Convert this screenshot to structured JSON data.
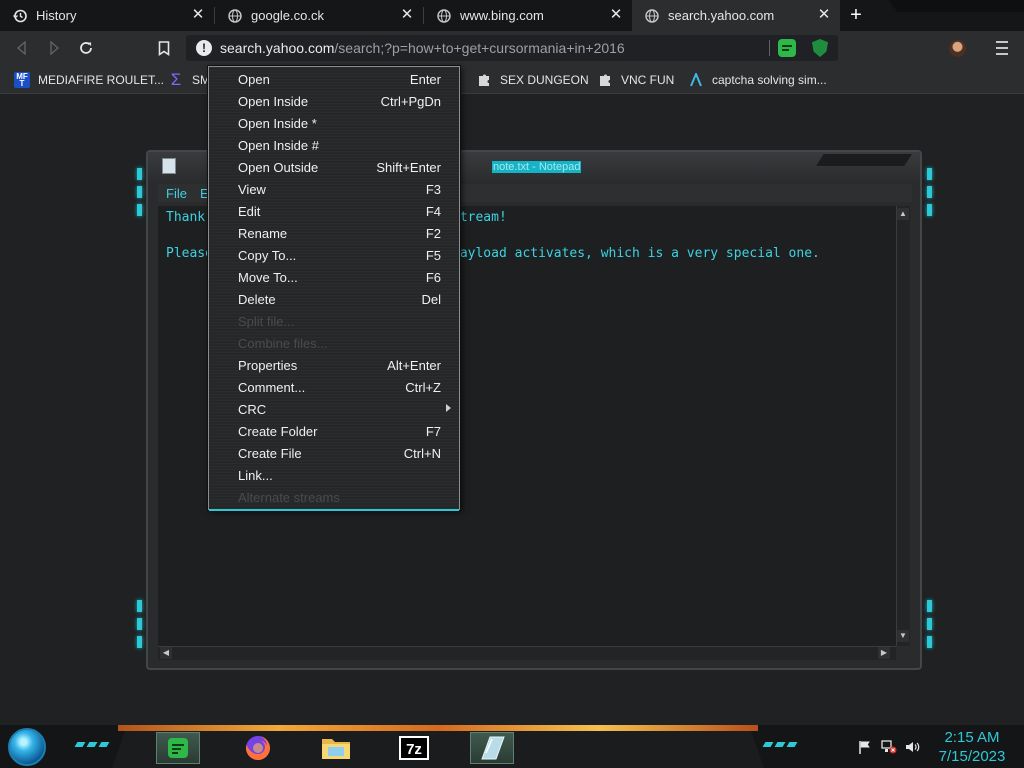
{
  "browser": {
    "tabs": [
      {
        "title": "History",
        "icon": "history-icon"
      },
      {
        "title": "google.co.ck",
        "icon": "globe-icon"
      },
      {
        "title": "www.bing.com",
        "icon": "globe-icon"
      },
      {
        "title": "search.yahoo.com",
        "icon": "globe-icon",
        "active": true
      }
    ],
    "address": {
      "host": "search.yahoo.com",
      "path": "/search;?p=how+to+get+cursormania+in+2016"
    },
    "bookmarks": [
      {
        "label": "MEDIAFIRE ROULET...",
        "icon": "mediafire-icon"
      },
      {
        "label": "SM",
        "icon": "sigma-icon"
      },
      {
        "label": "SEX DUNGEON",
        "icon": "puzzle-icon"
      },
      {
        "label": "VNC FUN",
        "icon": "puzzle-icon"
      },
      {
        "label": "captcha solving sim...",
        "icon": "arrow-logo-icon"
      }
    ]
  },
  "notepad": {
    "title": "note.txt - Notepad",
    "menu": [
      "File",
      "E"
    ],
    "lines": [
      {
        "left": "Thank",
        "right": "stream!"
      },
      {
        "left": "Please",
        "right": "payload activates, which is a very special one."
      }
    ]
  },
  "context_menu": {
    "items": [
      {
        "label": "Open",
        "shortcut": "Enter"
      },
      {
        "label": "Open Inside",
        "shortcut": "Ctrl+PgDn"
      },
      {
        "label": "Open Inside *",
        "shortcut": ""
      },
      {
        "label": "Open Inside #",
        "shortcut": ""
      },
      {
        "label": "Open Outside",
        "shortcut": "Shift+Enter"
      },
      {
        "label": "View",
        "shortcut": "F3"
      },
      {
        "label": "Edit",
        "shortcut": "F4"
      },
      {
        "label": "Rename",
        "shortcut": "F2"
      },
      {
        "label": "Copy To...",
        "shortcut": "F5"
      },
      {
        "label": "Move To...",
        "shortcut": "F6"
      },
      {
        "label": "Delete",
        "shortcut": "Del"
      },
      {
        "label": "Split file...",
        "shortcut": "",
        "disabled": true
      },
      {
        "label": "Combine files...",
        "shortcut": "",
        "disabled": true
      },
      {
        "label": "Properties",
        "shortcut": "Alt+Enter"
      },
      {
        "label": "Comment...",
        "shortcut": "Ctrl+Z"
      },
      {
        "label": "CRC",
        "shortcut": "",
        "submenu": true
      },
      {
        "label": "Create Folder",
        "shortcut": "F7"
      },
      {
        "label": "Create File",
        "shortcut": "Ctrl+N"
      },
      {
        "label": "Link...",
        "shortcut": ""
      },
      {
        "label": "Alternate streams",
        "shortcut": "",
        "disabled": true
      }
    ]
  },
  "taskbar": {
    "apps": [
      "notepad",
      "firefox",
      "file-explorer",
      "7-zip",
      "glass-app"
    ],
    "time": "2:15 AM",
    "date": "7/15/2023"
  },
  "colors": {
    "accent": "#2ec9d6",
    "text_cyan": "#3cd2e2"
  }
}
